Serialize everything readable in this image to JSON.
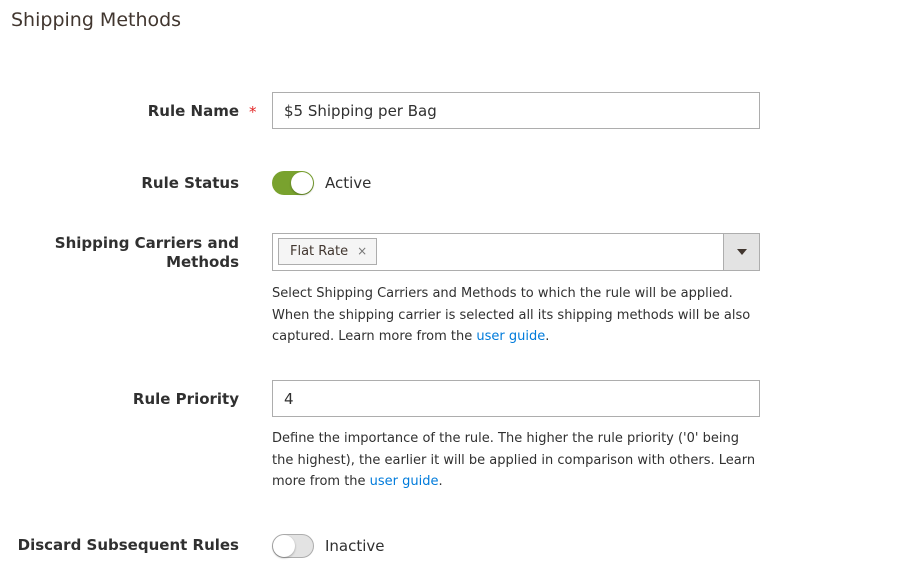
{
  "section": {
    "title": "Shipping Methods"
  },
  "rule_name": {
    "label": "Rule Name",
    "required_mark": "*",
    "value": "$5 Shipping per Bag"
  },
  "rule_status": {
    "label": "Rule Status",
    "state": "Active",
    "enabled": true
  },
  "carriers": {
    "label_line1": "Shipping Carriers and",
    "label_line2": "Methods",
    "selected": [
      {
        "label": "Flat Rate",
        "remove_glyph": "×"
      }
    ],
    "note_text": "Select Shipping Carriers and Methods to which the rule will be applied. When the shipping carrier is selected all its shipping methods will be also captured. Learn more from the ",
    "note_link": "user guide",
    "note_end": "."
  },
  "rule_priority": {
    "label": "Rule Priority",
    "value": "4",
    "note_text": "Define the importance of the rule. The higher the rule priority ('0' being the highest), the earlier it will be applied in comparison with others. Learn more from the ",
    "note_link": "user guide",
    "note_end": "."
  },
  "discard_rules": {
    "label": "Discard Subsequent Rules",
    "state": "Inactive",
    "enabled": false
  },
  "colors": {
    "toggle_on": "#79a22e",
    "link": "#007bdb",
    "required": "#e22626"
  }
}
